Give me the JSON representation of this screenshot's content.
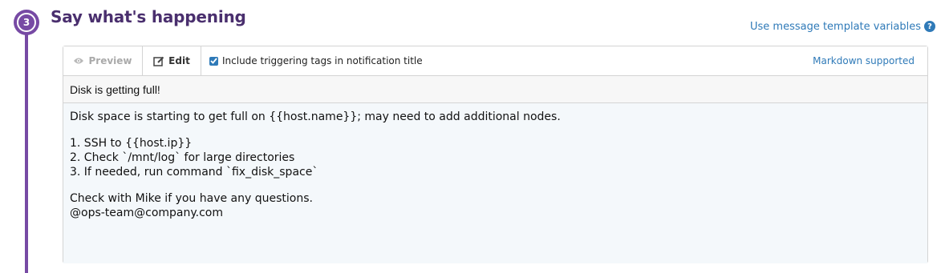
{
  "step": {
    "number": "3",
    "title": "Say what's happening"
  },
  "links": {
    "template_variables": "Use message template variables",
    "help": "?"
  },
  "toolbar": {
    "preview_label": "Preview",
    "edit_label": "Edit",
    "include_tags_label": "Include triggering tags in notification title",
    "include_tags_checked": true,
    "markdown_label": "Markdown supported"
  },
  "message": {
    "title": "Disk is getting full!",
    "body_lines": [
      "Disk space is starting to get full on {{host.name}}; may need to add additional nodes.",
      "",
      "1. SSH to {{host.ip}}",
      "2. Check `/mnt/log` for large directories",
      "3. If needed, run command `fix_disk_space`",
      "",
      "Check with Mike if you have any questions.",
      "@ops-team@company.com"
    ]
  },
  "colors": {
    "accent": "#774aa4",
    "title": "#4a2f6e",
    "link": "#2f7ab8"
  }
}
